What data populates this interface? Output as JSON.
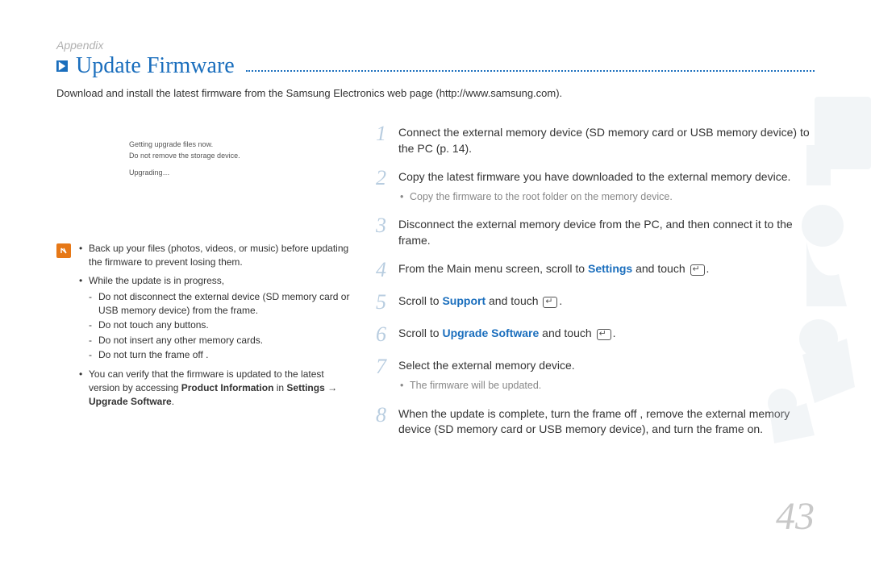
{
  "section": "Appendix",
  "title": "Update Firmware",
  "intro": "Download and install the latest firmware from the Samsung Electronics web page (http://www.samsung.com).",
  "status": {
    "line1": "Getting upgrade files now.",
    "line2": "Do not remove the storage device.",
    "line3": "Upgrading…"
  },
  "notes": {
    "item1_a": "Back up your files (photos, videos, or music) before updating the firmware to prevent losing them.",
    "item2_lead": "While the update is in progress,",
    "item2_sub1": "Do not disconnect the external device (SD memory card or USB memory device) from the frame.",
    "item2_sub2": "Do not touch any buttons.",
    "item2_sub3": "Do not insert any other memory cards.",
    "item2_sub4": "Do not turn the frame off .",
    "item3_a": "You can verify that the firmware is updated to the latest version by accessing ",
    "item3_b": "Product Information",
    "item3_c": " in ",
    "item3_d": "Settings → Upgrade Software",
    "item3_e": "."
  },
  "steps": {
    "s1": "Connect the external memory device (SD memory card or USB memory device) to the PC (p. 14).",
    "s2": "Copy the latest firmware you have downloaded to the external memory device.",
    "s2_sub": "Copy the firmware to the root folder on the memory device.",
    "s3": "Disconnect the external memory device from the PC, and then connect it to the frame.",
    "s4_a": "From the Main menu screen, scroll to ",
    "s4_b": "Settings",
    "s4_c": " and touch ",
    "s5_a": "Scroll to ",
    "s5_b": "Support",
    "s5_c": " and touch ",
    "s6_a": "Scroll to ",
    "s6_b": "Upgrade Software",
    "s6_c": " and touch ",
    "s7": "Select the external memory device.",
    "s7_sub": "The firmware will be updated.",
    "s8": "When the update is complete, turn the frame off , remove the external memory device (SD memory card or USB memory device), and turn the frame on."
  },
  "page_number": "43"
}
